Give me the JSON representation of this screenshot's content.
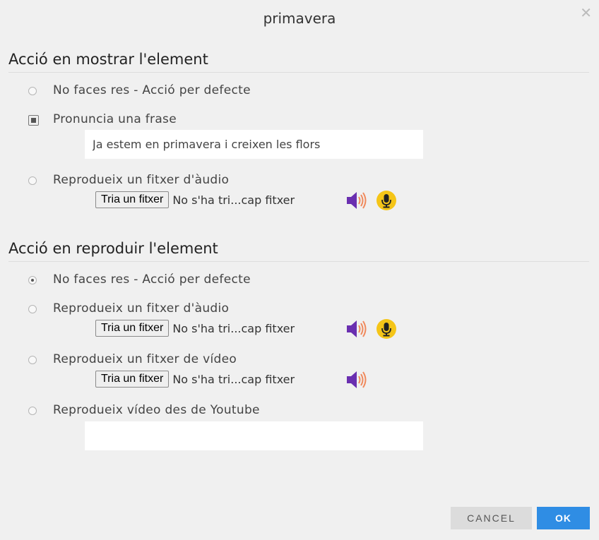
{
  "dialog": {
    "title": "primavera",
    "close_icon": "close-icon"
  },
  "show_section": {
    "header": "Acció en mostrar l'element",
    "options": [
      {
        "label": "No faces res - Acció per defecte",
        "selected": false
      },
      {
        "label": "Pronuncia una frase",
        "selected": true
      },
      {
        "label": "Reprodueix un fitxer d'àudio",
        "selected": false
      }
    ],
    "phrase_value": "Ja estem en primavera i creixen les flors",
    "audio_file": {
      "button_label": "Tria un fitxer",
      "status": "No s'ha tri...cap fitxer"
    }
  },
  "play_section": {
    "header": "Acció en reproduir l'element",
    "options": [
      {
        "label": "No faces res - Acció per defecte",
        "selected": true
      },
      {
        "label": "Reprodueix un fitxer d'àudio",
        "selected": false
      },
      {
        "label": "Reprodueix un fitxer de vídeo",
        "selected": false
      },
      {
        "label": "Reprodueix vídeo des de Youtube",
        "selected": false
      }
    ],
    "audio_file": {
      "button_label": "Tria un fitxer",
      "status": "No s'ha tri...cap fitxer"
    },
    "video_file": {
      "button_label": "Tria un fitxer",
      "status": "No s'ha tri...cap fitxer"
    },
    "youtube_value": ""
  },
  "footer": {
    "cancel_label": "CANCEL",
    "ok_label": "OK"
  },
  "colors": {
    "ok_button": "#2f8de4",
    "speaker_icon": "#6a2fb0",
    "mic_icon": "#f5c518"
  }
}
